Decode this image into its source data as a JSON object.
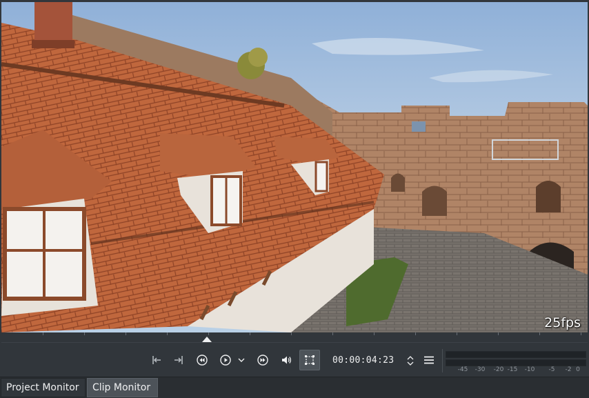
{
  "monitor": {
    "fps_label": "25fps",
    "timecode": "00:00:04:23"
  },
  "controls": {
    "zone_in_icon": "zone-in-icon",
    "zone_out_icon": "zone-out-icon",
    "rewind_icon": "seek-backward-icon",
    "play_icon": "play-icon",
    "play_menu_icon": "chevron-down-icon",
    "forward_icon": "seek-forward-icon",
    "volume_icon": "volume-icon",
    "edit_mode_icon": "transform-icon",
    "menu_icon": "hamburger-menu-icon"
  },
  "audio_meter": {
    "scale": [
      "-45",
      "-30",
      "-20",
      "-15",
      "-10",
      "-5",
      "-2",
      "0"
    ]
  },
  "tabs": [
    {
      "label": "Project Monitor",
      "active": false
    },
    {
      "label": "Clip Monitor",
      "active": true
    }
  ],
  "colors": {
    "panel": "#31363b",
    "active": "#4d5359",
    "text": "#eff0f1"
  }
}
